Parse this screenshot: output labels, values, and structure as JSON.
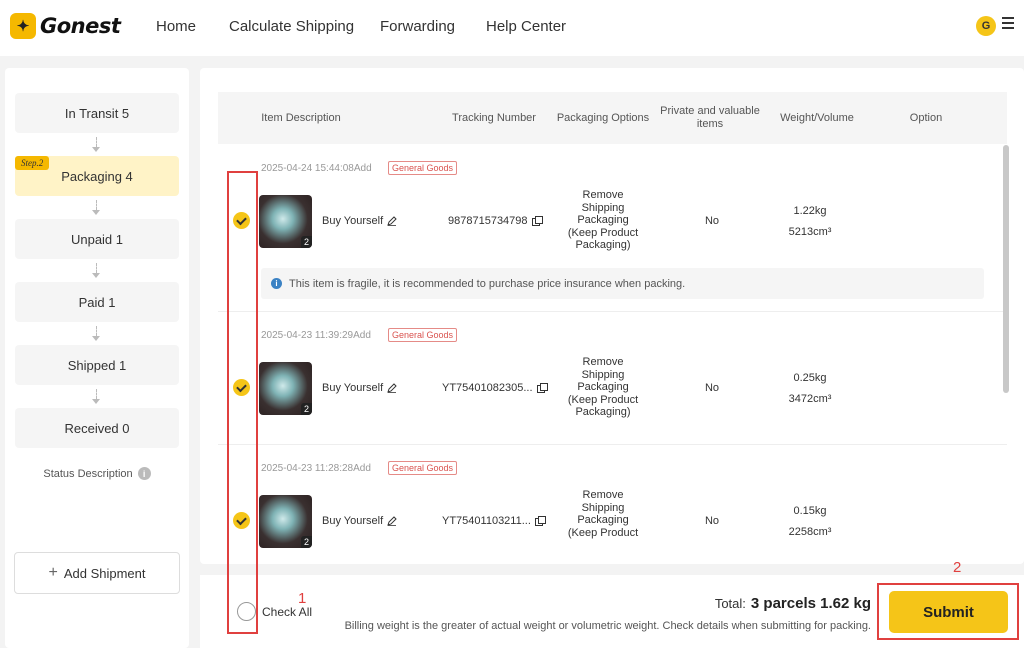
{
  "brand": {
    "name": "Gonest"
  },
  "nav": [
    "Home",
    "Calculate Shipping",
    "Forwarding",
    "Help Center"
  ],
  "user": {
    "initial": "G"
  },
  "sidebar": {
    "steps": [
      {
        "label": "In Transit 5"
      },
      {
        "label": "Packaging 4",
        "tag": "Step.2",
        "active": true
      },
      {
        "label": "Unpaid 1"
      },
      {
        "label": "Paid 1"
      },
      {
        "label": "Shipped 1"
      },
      {
        "label": "Received 0"
      }
    ],
    "status_description": "Status Description",
    "add_shipment": "Add Shipment"
  },
  "table": {
    "headers": [
      "Item Description",
      "Tracking Number",
      "Packaging Options",
      "Private and valuable items",
      "Weight/Volume",
      "Option"
    ],
    "rows": [
      {
        "date": "2025-04-24 15:44:08Add",
        "badge": "General Goods",
        "qty": "2",
        "buy": "Buy Yourself",
        "tracking": "9878715734798",
        "packaging": "Remove Shipping Packaging (Keep Product Packaging)",
        "private": "No",
        "weight": "1.22kg",
        "volume": "5213cm³",
        "notice": "This item is fragile, it is recommended to purchase price insurance when packing."
      },
      {
        "date": "2025-04-23 11:39:29Add",
        "badge": "General Goods",
        "qty": "2",
        "buy": "Buy Yourself",
        "tracking": "YT75401082305...",
        "packaging": "Remove Shipping Packaging (Keep Product Packaging)",
        "private": "No",
        "weight": "0.25kg",
        "volume": "3472cm³"
      },
      {
        "date": "2025-04-23 11:28:28Add",
        "badge": "General Goods",
        "qty": "2",
        "buy": "Buy Yourself",
        "tracking": "YT75401103211...",
        "packaging": "Remove Shipping Packaging (Keep Product",
        "private": "No",
        "weight": "0.15kg",
        "volume": "2258cm³"
      }
    ]
  },
  "footer": {
    "check_all": "Check All",
    "total_label": "Total:",
    "total_value": "3 parcels 1.62 kg",
    "billing_note": "Billing weight is the greater of actual weight or volumetric weight. Check details when submitting for packing.",
    "submit": "Submit"
  },
  "annotations": {
    "one": "1",
    "two": "2"
  },
  "colors": {
    "accent": "#f5c518",
    "annotation": "#e0403f",
    "badge": "#d9534f"
  }
}
